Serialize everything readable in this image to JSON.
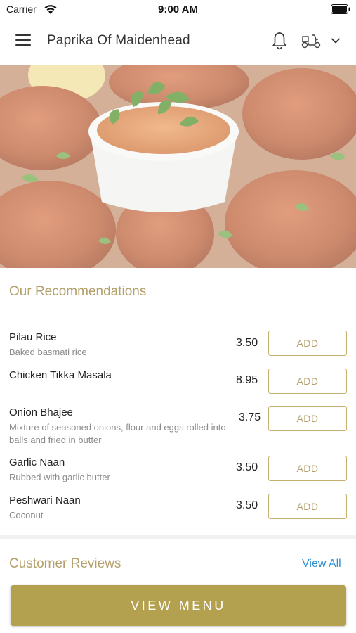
{
  "status_bar": {
    "carrier": "Carrier",
    "time": "9:00 AM"
  },
  "header": {
    "title": "Paprika Of Maidenhead",
    "icons": [
      "menu-icon",
      "bell-icon",
      "delivery-icon",
      "chevron-down-icon"
    ]
  },
  "hero": {
    "image": "tandoori-chicken-with-dip"
  },
  "recommendations": {
    "title": "Our Recommendations",
    "items": [
      {
        "name": "Pilau Rice",
        "description": "Baked basmati rice",
        "price": "3.50",
        "add_label": "ADD"
      },
      {
        "name": "Chicken Tikka Masala",
        "description": "",
        "price": "8.95",
        "add_label": "ADD"
      },
      {
        "name": "Onion Bhajee",
        "description": "Mixture of seasoned onions, flour and eggs rolled into balls and fried in butter",
        "price": "3.75",
        "add_label": "ADD"
      },
      {
        "name": "Garlic Naan",
        "description": "Rubbed with garlic butter",
        "price": "3.50",
        "add_label": "ADD"
      },
      {
        "name": "Peshwari Naan",
        "description": "Coconut",
        "price": "3.50",
        "add_label": "ADD"
      }
    ]
  },
  "reviews": {
    "title": "Customer Reviews",
    "view_all_label": "View All"
  },
  "footer": {
    "view_menu_label": "VIEW MENU"
  },
  "colors": {
    "accent": "#b3a14f",
    "accent_text": "#b3a06a",
    "link": "#2b8fd1"
  }
}
